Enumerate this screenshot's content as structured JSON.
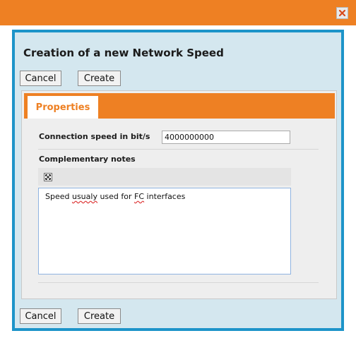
{
  "window": {
    "close_icon": "close-icon"
  },
  "dialog": {
    "title": "Creation of a new Network Speed",
    "cancel_label": "Cancel",
    "create_label": "Create",
    "tabs": [
      {
        "label": "Properties"
      }
    ],
    "connection_speed": {
      "label": "Connection speed in bit/s",
      "value": "4000000000"
    },
    "notes": {
      "label": "Complementary notes",
      "toolbar_icon": "maximize-icon",
      "text_parts": [
        "Speed ",
        "usualy",
        " used for ",
        "FC",
        " interfaces"
      ]
    }
  },
  "colors": {
    "accent": "#ee8023",
    "border": "#1d94c9",
    "dialog_bg": "#d4e7ef"
  }
}
